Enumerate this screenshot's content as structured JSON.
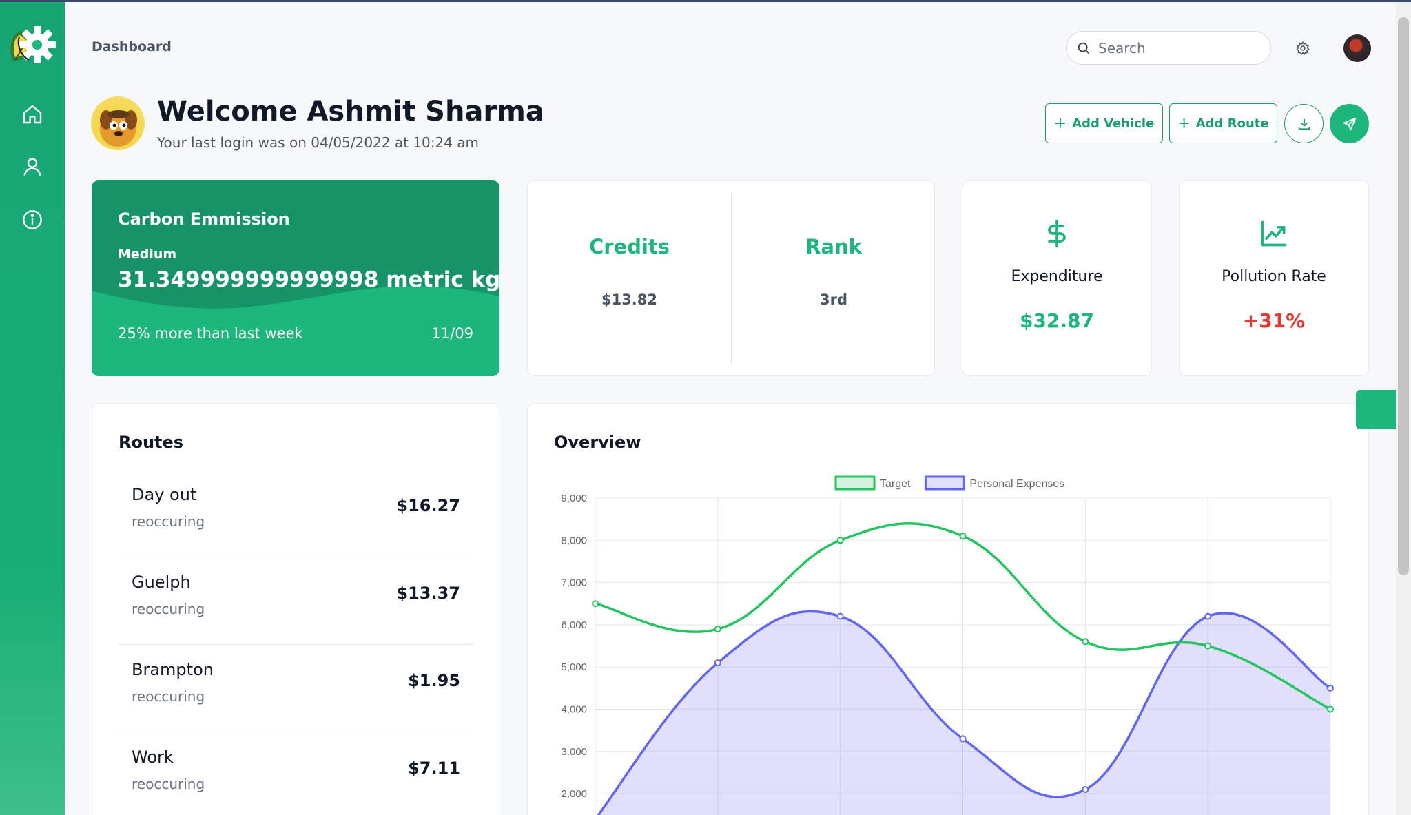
{
  "header": {
    "breadcrumb": "Dashboard",
    "search_placeholder": "Search"
  },
  "welcome": {
    "title": "Welcome Ashmit Sharma",
    "subtitle": "Your last login was on 04/05/2022 at 10:24 am"
  },
  "actions": {
    "add_vehicle": "Add Vehicle",
    "add_route": "Add Route",
    "download_icon": "download-icon",
    "send_icon": "send-icon"
  },
  "carbon": {
    "title": "Carbon Emmission",
    "level": "Medium",
    "value": "31.349999999999998 metric kgs",
    "comparison": "25% more than last week",
    "date": "11/09"
  },
  "stats": {
    "credits_label": "Credits",
    "credits_value": "$13.82",
    "rank_label": "Rank",
    "rank_value": "3rd"
  },
  "expenditure": {
    "label": "Expenditure",
    "value": "$32.87",
    "icon": "dollar-icon",
    "color": "#1db67c"
  },
  "pollution": {
    "label": "Pollution Rate",
    "value": "+31%",
    "icon": "trending-up-icon",
    "color": "#e53935"
  },
  "routes": {
    "title": "Routes",
    "items": [
      {
        "name": "Day out",
        "type": "reoccuring",
        "price": "$16.27"
      },
      {
        "name": "Guelph",
        "type": "reoccuring",
        "price": "$13.37"
      },
      {
        "name": "Brampton",
        "type": "reoccuring",
        "price": "$1.95"
      },
      {
        "name": "Work",
        "type": "reoccuring",
        "price": "$7.11"
      }
    ]
  },
  "overview": {
    "title": "Overview"
  },
  "chart_data": {
    "type": "line",
    "x": [
      0,
      1,
      2,
      3,
      4,
      5,
      6
    ],
    "ylim": [
      2000,
      9000
    ],
    "y_ticks": [
      "9,000",
      "8,000",
      "7,000",
      "6,000",
      "5,000",
      "4,000",
      "3,000",
      "2,000"
    ],
    "grid": true,
    "legend_position": "top",
    "series": [
      {
        "name": "Target",
        "values": [
          6500,
          5900,
          8000,
          8100,
          5600,
          5500,
          4000
        ],
        "color": "#22c55e",
        "fill": false
      },
      {
        "name": "Personal Expenses",
        "values": [
          1400,
          5100,
          6200,
          3300,
          2100,
          6200,
          4500
        ],
        "color": "#6366f1",
        "fill": true
      }
    ]
  }
}
